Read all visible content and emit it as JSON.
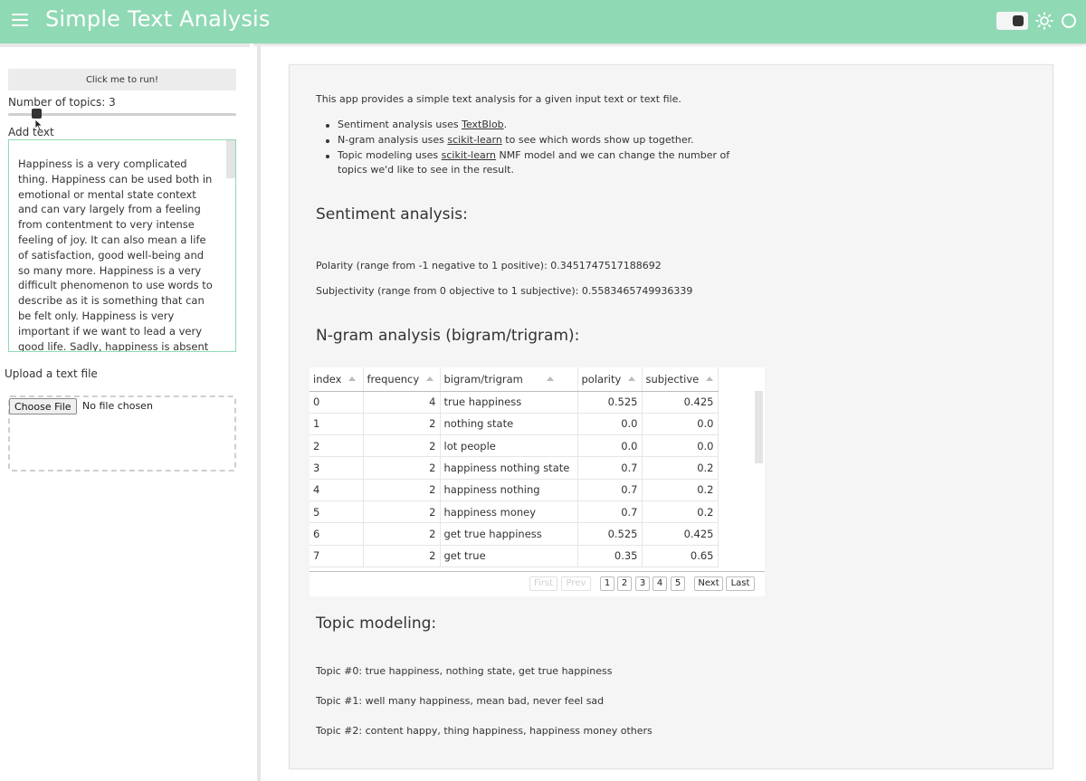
{
  "header": {
    "title": "Simple Text Analysis"
  },
  "sidebar": {
    "run_button": "Click me to run!",
    "topics_label": "Number of topics: 3",
    "topics_value": 3,
    "add_text_label": "Add text",
    "text_value": "Happiness is a very complicated thing. Happiness can be used both in emotional or mental state context and can vary largely from a feeling from contentment to very intense feeling of joy. It can also mean a life of satisfaction, good well-being and so many more. Happiness is a very difficult phenomenon to use words to describe as it is something that can be felt only. Happiness is very important if we want to lead a very good life. Sadly, happiness is absent from the lives of a",
    "upload_label": "Upload a text file",
    "choose_file": "Choose File",
    "no_file": "No file chosen"
  },
  "main": {
    "intro": "This app provides a simple text analysis for a given input text or text file.",
    "bullets": [
      {
        "pre": "Sentiment analysis uses ",
        "link": "TextBlob",
        "post": "."
      },
      {
        "pre": "N-gram analysis uses ",
        "link": "scikit-learn",
        "post": " to see which words show up together."
      },
      {
        "pre": "Topic modeling uses ",
        "link": "scikit-learn",
        "post": " NMF model and we can change the number of topics we'd like to see in the result."
      }
    ],
    "sentiment_heading": "Sentiment analysis:",
    "polarity": "Polarity (range from -1 negative to 1 positive): 0.3451747517188692",
    "subjectivity": "Subjectivity (range from 0 objective to 1 subjective): 0.5583465749936339",
    "ngram_heading": "N-gram analysis (bigram/trigram):",
    "table": {
      "columns": [
        "index",
        "frequency",
        "bigram/trigram",
        "polarity",
        "subjective"
      ],
      "rows": [
        [
          "0",
          "4",
          "true happiness",
          "0.525",
          "0.425"
        ],
        [
          "1",
          "2",
          "nothing state",
          "0.0",
          "0.0"
        ],
        [
          "2",
          "2",
          "lot people",
          "0.0",
          "0.0"
        ],
        [
          "3",
          "2",
          "happiness nothing state",
          "0.7",
          "0.2"
        ],
        [
          "4",
          "2",
          "happiness nothing",
          "0.7",
          "0.2"
        ],
        [
          "5",
          "2",
          "happiness money",
          "0.7",
          "0.2"
        ],
        [
          "6",
          "2",
          "get true happiness",
          "0.525",
          "0.425"
        ],
        [
          "7",
          "2",
          "get true",
          "0.35",
          "0.65"
        ]
      ],
      "pager": {
        "first": "First",
        "prev": "Prev",
        "pages": [
          "1",
          "2",
          "3",
          "4",
          "5"
        ],
        "next": "Next",
        "last": "Last"
      }
    },
    "topic_heading": "Topic modeling:",
    "topics": [
      "Topic #0: true happiness, nothing state, get true happiness",
      "Topic #1: well many happiness, mean bad, never feel sad",
      "Topic #2: content happy, thing happiness, happiness money others"
    ]
  }
}
